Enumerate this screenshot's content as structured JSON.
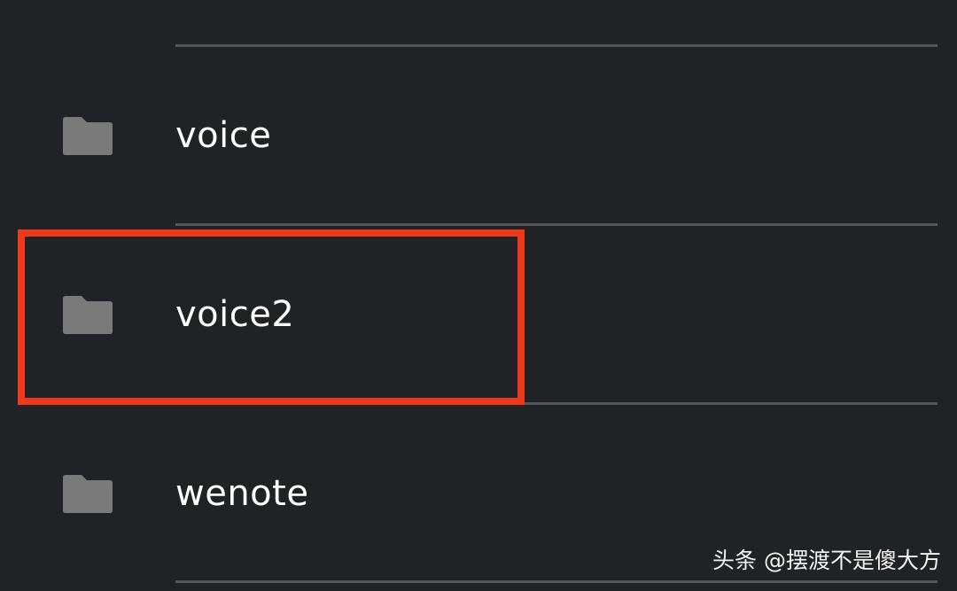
{
  "colors": {
    "background": "#212226",
    "divider": "#54565a",
    "folder_icon": "#7a7a7a",
    "text": "#ffffff",
    "highlight": "#ee3a1c"
  },
  "folders": [
    {
      "name": "voice",
      "icon": "folder-icon"
    },
    {
      "name": "voice2",
      "icon": "folder-icon",
      "highlighted": true
    },
    {
      "name": "wenote",
      "icon": "folder-icon"
    }
  ],
  "watermark": {
    "text": "头条 @摆渡不是傻大方"
  }
}
